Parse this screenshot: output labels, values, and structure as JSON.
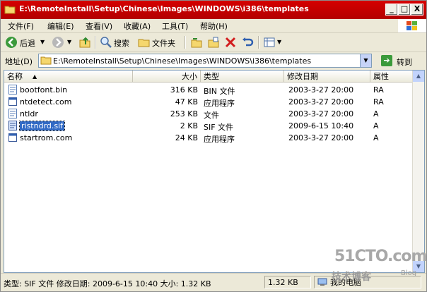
{
  "window": {
    "title": "E:\\RemoteInstall\\Setup\\Chinese\\Images\\WINDOWS\\i386\\templates",
    "minimize": "_",
    "maximize": "□",
    "close": "X"
  },
  "menu": [
    {
      "label": "文件(F)"
    },
    {
      "label": "编辑(E)"
    },
    {
      "label": "查看(V)"
    },
    {
      "label": "收藏(A)"
    },
    {
      "label": "工具(T)"
    },
    {
      "label": "帮助(H)"
    }
  ],
  "toolbar": {
    "back_label": "后退",
    "search_label": "搜索",
    "folders_label": "文件夹"
  },
  "address": {
    "label": "地址(D)",
    "value": "E:\\RemoteInstall\\Setup\\Chinese\\Images\\WINDOWS\\i386\\templates",
    "go_label": "转到"
  },
  "columns": {
    "name": "名称",
    "size": "大小",
    "type": "类型",
    "modified": "修改日期",
    "attributes": "属性"
  },
  "files": [
    {
      "name": "bootfont.bin",
      "size": "316 KB",
      "type": "BIN 文件",
      "modified": "2003-3-27 20:00",
      "attr": "RA"
    },
    {
      "name": "ntdetect.com",
      "size": "47 KB",
      "type": "应用程序",
      "modified": "2003-3-27 20:00",
      "attr": "RA"
    },
    {
      "name": "ntldr",
      "size": "253 KB",
      "type": "文件",
      "modified": "2003-3-27 20:00",
      "attr": "A"
    },
    {
      "name": "ristndrd.sif",
      "size": "2 KB",
      "type": "SIF 文件",
      "modified": "2009-6-15 10:40",
      "attr": "A",
      "selected": true
    },
    {
      "name": "startrom.com",
      "size": "24 KB",
      "type": "应用程序",
      "modified": "2003-3-27 20:00",
      "attr": "A"
    }
  ],
  "status": {
    "text": "类型: SIF 文件 修改日期: 2009-6-15 10:40 大小: 1.32 KB",
    "size": "1.32 KB",
    "zone": "我的电脑"
  },
  "watermark": {
    "site": "51CTO.com",
    "slogan": "技术博客",
    "blog": "Blog"
  }
}
